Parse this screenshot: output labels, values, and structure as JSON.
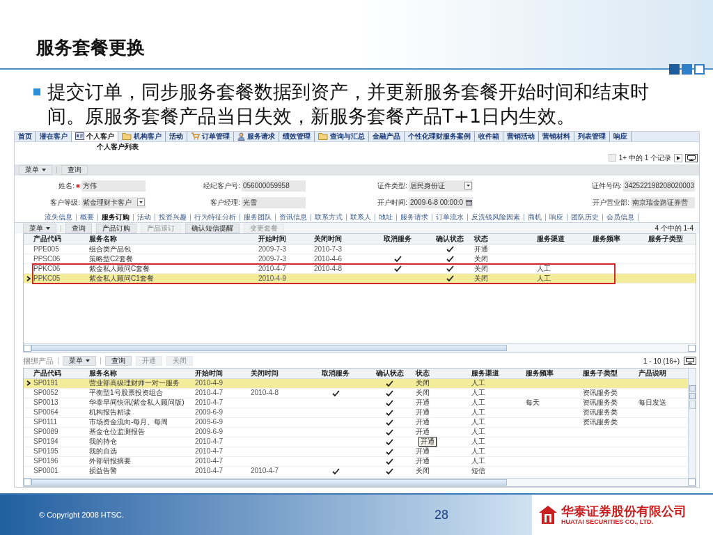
{
  "slide": {
    "title": "服务套餐更换",
    "bullet": "提交订单，同步服务套餐数据到资产，并更新服务套餐开始时间和结束时间。原服务套餐产品当日失效，新服务套餐产品T+1日内生效。",
    "copyright": "© Copyright 2008 HTSC.",
    "page_number": "28",
    "logo_cn": "华泰证券股份有限公司",
    "logo_en": "HUATAI SECURITIES CO., LTD."
  },
  "nav": [
    {
      "label": "首页",
      "kind": "plain",
      "selected": false
    },
    {
      "label": "潜在客户",
      "kind": "plain",
      "selected": false
    },
    {
      "label": "个人客户",
      "kind": "card",
      "selected": true
    },
    {
      "label": "机构客户",
      "kind": "folder",
      "selected": false
    },
    {
      "label": "活动",
      "kind": "plain",
      "selected": false
    },
    {
      "label": "订单管理",
      "kind": "cart",
      "selected": false
    },
    {
      "label": "服务请求",
      "kind": "person",
      "selected": false
    },
    {
      "label": "绩效管理",
      "kind": "plain",
      "selected": false
    },
    {
      "label": "查询与汇总",
      "kind": "folder",
      "selected": false
    },
    {
      "label": "金融产品",
      "kind": "plain",
      "selected": false
    },
    {
      "label": "个性化理财服务案例",
      "kind": "plain",
      "selected": false
    },
    {
      "label": "收件箱",
      "kind": "plain",
      "selected": false
    },
    {
      "label": "营销活动",
      "kind": "plain",
      "selected": false
    },
    {
      "label": "营销材料",
      "kind": "plain",
      "selected": false
    },
    {
      "label": "列表管理",
      "kind": "plain",
      "selected": false
    },
    {
      "label": "响应",
      "kind": "plain",
      "selected": false
    }
  ],
  "subtitle": "个人客户列表",
  "pager": "1+ 中的 1 个记录",
  "toolbar": [
    {
      "label": "菜单",
      "kind": "menu"
    },
    {
      "label": "查询",
      "kind": "button"
    }
  ],
  "fields": [
    {
      "label": "姓名:",
      "required": true,
      "value": "方伟",
      "kind": "text"
    },
    {
      "label": "经纪客户号:",
      "required": false,
      "value": "056000059958",
      "kind": "text"
    },
    {
      "label": "证件类型:",
      "required": false,
      "value": "居民身份证",
      "kind": "select"
    },
    {
      "label": "证件号码:",
      "required": false,
      "value": "342522198208020003",
      "kind": "text"
    },
    {
      "label": "客户等级:",
      "required": false,
      "value": "紫金理财卡客户",
      "kind": "select"
    },
    {
      "label": "客户经理:",
      "required": false,
      "value": "光雪",
      "kind": "text"
    },
    {
      "label": "开户时间:",
      "required": false,
      "value": "2009-6-8 00:00:0",
      "kind": "date"
    },
    {
      "label": "开户营业部:",
      "required": false,
      "value": "南京瑞金路证券营",
      "kind": "text"
    }
  ],
  "detail_tabs": [
    {
      "label": "流失信息",
      "selected": false
    },
    {
      "label": "概要",
      "selected": false
    },
    {
      "label": "服务订购",
      "selected": true
    },
    {
      "label": "活动",
      "selected": false
    },
    {
      "label": "投资兴趣",
      "selected": false
    },
    {
      "label": "行为特征分析",
      "selected": false
    },
    {
      "label": "服务团队",
      "selected": false
    },
    {
      "label": "资讯信息",
      "selected": false
    },
    {
      "label": "联系方式",
      "selected": false
    },
    {
      "label": "联系人",
      "selected": false
    },
    {
      "label": "地址",
      "selected": false
    },
    {
      "label": "服务请求",
      "selected": false
    },
    {
      "label": "订单流水",
      "selected": false
    },
    {
      "label": "反洗钱风险因素",
      "selected": false
    },
    {
      "label": "商机",
      "selected": false
    },
    {
      "label": "响应",
      "selected": false
    },
    {
      "label": "团队历史",
      "selected": false
    },
    {
      "label": "会员信息",
      "selected": false
    }
  ],
  "services": {
    "toolbar": [
      {
        "label": "菜单",
        "kind": "menu",
        "disabled": false
      },
      {
        "label": "查询",
        "kind": "button",
        "disabled": false
      },
      {
        "label": "产品订购",
        "kind": "button",
        "disabled": false
      },
      {
        "label": "产品退订",
        "kind": "button",
        "disabled": true
      },
      {
        "label": "确认短信提醒",
        "kind": "button",
        "disabled": false
      },
      {
        "label": "变更套餐",
        "kind": "button",
        "disabled": true
      }
    ],
    "count": "4 个中的 1-4",
    "columns": [
      "产品代码",
      "服务名称",
      "开始时间",
      "关闭时间",
      "取消服务",
      "确认状态",
      "状态",
      "服务渠道",
      "服务频率",
      "服务子类型"
    ],
    "rows": [
      {
        "code": "PPE005",
        "name": "组合类产品包",
        "start": "2009-7-3",
        "end": "2010-7-3",
        "cancelled": false,
        "confirmed": true,
        "status": "开通",
        "selected": false,
        "highlighted": false
      },
      {
        "code": "PPSC06",
        "name": "策略型C2套餐",
        "start": "2009-7-3",
        "end": "2010-4-6",
        "cancelled": true,
        "confirmed": true,
        "status": "关闭",
        "selected": false,
        "highlighted": false
      },
      {
        "code": "PPKC06",
        "name": "紫金私人顾问C套餐",
        "start": "2010-4-7",
        "end": "2010-4-8",
        "cancelled": true,
        "confirmed": true,
        "status": "关闭",
        "channel": "人工",
        "selected": false,
        "highlighted": true
      },
      {
        "code": "PPKC05",
        "name": "紫金私人顾问C1套餐",
        "start": "2010-4-9",
        "cancelled": false,
        "confirmed": true,
        "status": "关闭",
        "channel": "人工",
        "selected": true,
        "highlighted": true
      }
    ]
  },
  "bundle": {
    "title": "捆绑产品",
    "toolbar": [
      {
        "label": "菜单",
        "kind": "menu",
        "disabled": false
      },
      {
        "label": "查询",
        "kind": "button",
        "disabled": false
      },
      {
        "label": "开通",
        "kind": "button",
        "disabled": true
      },
      {
        "label": "关闭",
        "kind": "button",
        "disabled": true
      }
    ],
    "count": "1 - 10 (16+)",
    "columns": [
      "产品代码",
      "服务名称",
      "开始时间",
      "关闭时间",
      "取消服务",
      "确认状态",
      "状态",
      "服务渠道",
      "服务频率",
      "服务子类型",
      "产品说明"
    ],
    "rows": [
      {
        "code": "SP0191",
        "name": "营业部高级理财师一对一服务",
        "start": "2010-4-9",
        "cancelled": false,
        "confirmed": true,
        "status": "关闭",
        "channel": "人工",
        "selected": true
      },
      {
        "code": "SP0052",
        "name": "平衡型1号股票投资组合",
        "start": "2010-4-7",
        "end": "2010-4-8",
        "cancelled": true,
        "confirmed": true,
        "status": "关闭",
        "channel": "人工",
        "subtype": "资讯服务类",
        "selected": false
      },
      {
        "code": "SP0013",
        "name": "华泰早间快讯(紫金私人顾问版)",
        "start": "2010-4-7",
        "cancelled": false,
        "confirmed": true,
        "status": "开通",
        "channel": "人工",
        "frequency": "每天",
        "subtype": "资讯服务类",
        "description": "每日发送",
        "selected": false
      },
      {
        "code": "SP0064",
        "name": "机构报告精读",
        "start": "2009-6-9",
        "cancelled": false,
        "confirmed": true,
        "status": "开通",
        "channel": "人工",
        "subtype": "资讯服务类",
        "selected": false
      },
      {
        "code": "SP0111",
        "name": "市场资金流向-每月、每周",
        "start": "2009-6-9",
        "cancelled": false,
        "confirmed": true,
        "status": "开通",
        "channel": "人工",
        "subtype": "资讯服务类",
        "selected": false
      },
      {
        "code": "SP0089",
        "name": "基金仓位监测报告",
        "start": "2009-6-9",
        "cancelled": false,
        "confirmed": true,
        "status": "开通",
        "channel": "人工",
        "selected": false
      },
      {
        "code": "SP0194",
        "name": "我的持仓",
        "start": "2010-4-7",
        "cancelled": false,
        "confirmed": true,
        "tooltip": "开通",
        "channel": "人工",
        "selected": false
      },
      {
        "code": "SP0195",
        "name": "我的自选",
        "start": "2010-4-7",
        "cancelled": false,
        "confirmed": true,
        "status": "开通",
        "channel": "人工",
        "selected": false
      },
      {
        "code": "SP0196",
        "name": "外部研报摘要",
        "start": "2010-4-7",
        "cancelled": false,
        "confirmed": true,
        "status": "开通",
        "channel": "人工",
        "selected": false
      },
      {
        "code": "SP0001",
        "name": "损益告警",
        "start": "2010-4-7",
        "end": "2010-4-7",
        "cancelled": true,
        "confirmed": true,
        "status": "关闭",
        "channel": "短信",
        "selected": false
      }
    ]
  }
}
